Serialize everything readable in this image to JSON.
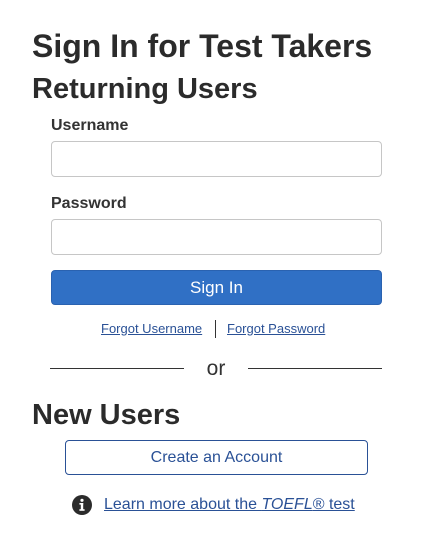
{
  "page": {
    "title": "Sign In for Test Takers"
  },
  "returning_users": {
    "heading": "Returning Users",
    "username": {
      "label": "Username",
      "value": "",
      "placeholder": ""
    },
    "password": {
      "label": "Password",
      "value": "",
      "placeholder": ""
    },
    "sign_in_label": "Sign In",
    "forgot_username_label": "Forgot Username",
    "forgot_password_label": "Forgot Password"
  },
  "divider": {
    "label": "or"
  },
  "new_users": {
    "heading": "New Users",
    "create_account_label": "Create an Account"
  },
  "learn_more": {
    "prefix": "Learn more about the ",
    "emphasis": "TOEFL",
    "suffix": "® test",
    "icon": "info-circle-icon"
  },
  "colors": {
    "primary": "#3070c5",
    "link": "#2a5196",
    "text": "#333333",
    "heading": "#2b2b2b"
  }
}
